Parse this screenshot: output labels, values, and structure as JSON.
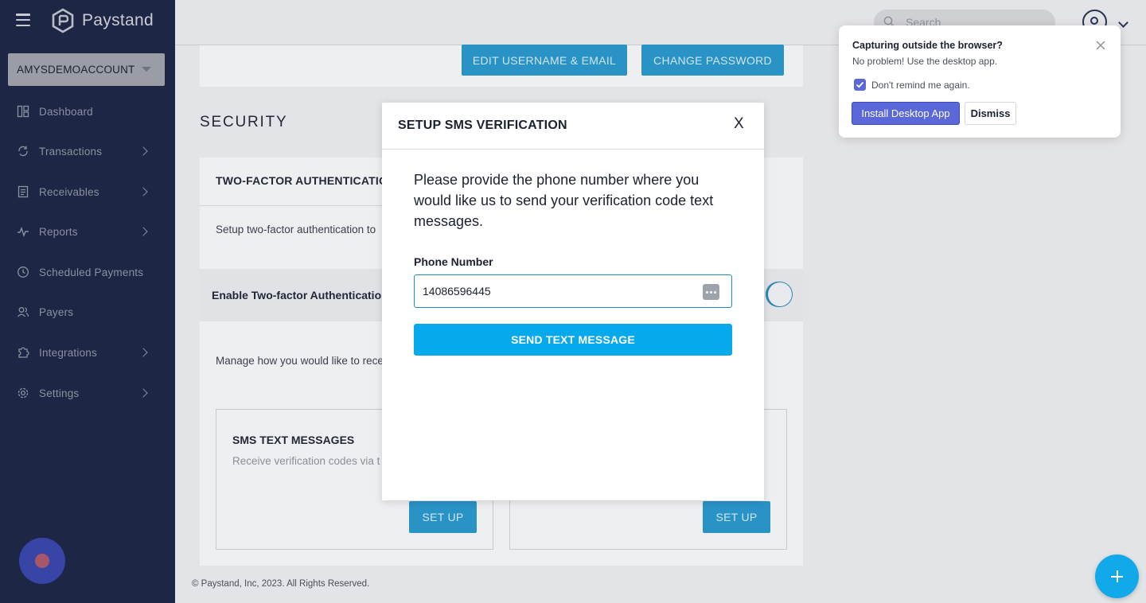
{
  "brand": {
    "name": "Paystand"
  },
  "account": {
    "name": "AMYSDEMOACCOUNT"
  },
  "sidebar": {
    "items": [
      {
        "label": "Dashboard",
        "icon": "dashboard-icon"
      },
      {
        "label": "Transactions",
        "icon": "transactions-icon"
      },
      {
        "label": "Receivables",
        "icon": "receivables-icon"
      },
      {
        "label": "Reports",
        "icon": "reports-icon"
      },
      {
        "label": "Scheduled Payments",
        "icon": "clock-icon"
      },
      {
        "label": "Payers",
        "icon": "users-icon"
      },
      {
        "label": "Integrations",
        "icon": "puzzle-icon"
      },
      {
        "label": "Settings",
        "icon": "gear-icon"
      }
    ]
  },
  "topbar": {
    "search_placeholder": "Search"
  },
  "profile": {
    "edit_button": "EDIT USERNAME & EMAIL",
    "password_button": "CHANGE PASSWORD"
  },
  "security": {
    "title": "SECURITY",
    "card_title": "TWO-FACTOR AUTHENTICATIO",
    "setup_text": "Setup two-factor authentication to",
    "enable_label": "Enable Two-factor Authentication",
    "manage_text": "Manage how you would like to rece",
    "sms_card": {
      "title": "SMS TEXT MESSAGES",
      "desc": "Receive verification codes via t",
      "button": "SET UP"
    },
    "other_card": {
      "button": "SET UP"
    }
  },
  "footer": {
    "text": "© Paystand, Inc, 2023. All Rights Reserved."
  },
  "modal": {
    "title": "SETUP SMS VERIFICATION",
    "close": "X",
    "description": "Please provide the phone number where you would like us to send your verification code text messages.",
    "phone_label": "Phone Number",
    "phone_value": "14086596445",
    "send_button": "SEND TEXT MESSAGE"
  },
  "desktop_popup": {
    "title": "Capturing outside the browser?",
    "subtitle": "No problem! Use the desktop app.",
    "checkbox_label": "Don't remind me again.",
    "checkbox_checked": true,
    "install_button": "Install Desktop App",
    "dismiss_button": "Dismiss"
  },
  "colors": {
    "sidebar_bg": "#1d2644",
    "primary": "#06aaeb",
    "popup_accent": "#5b68d9"
  }
}
